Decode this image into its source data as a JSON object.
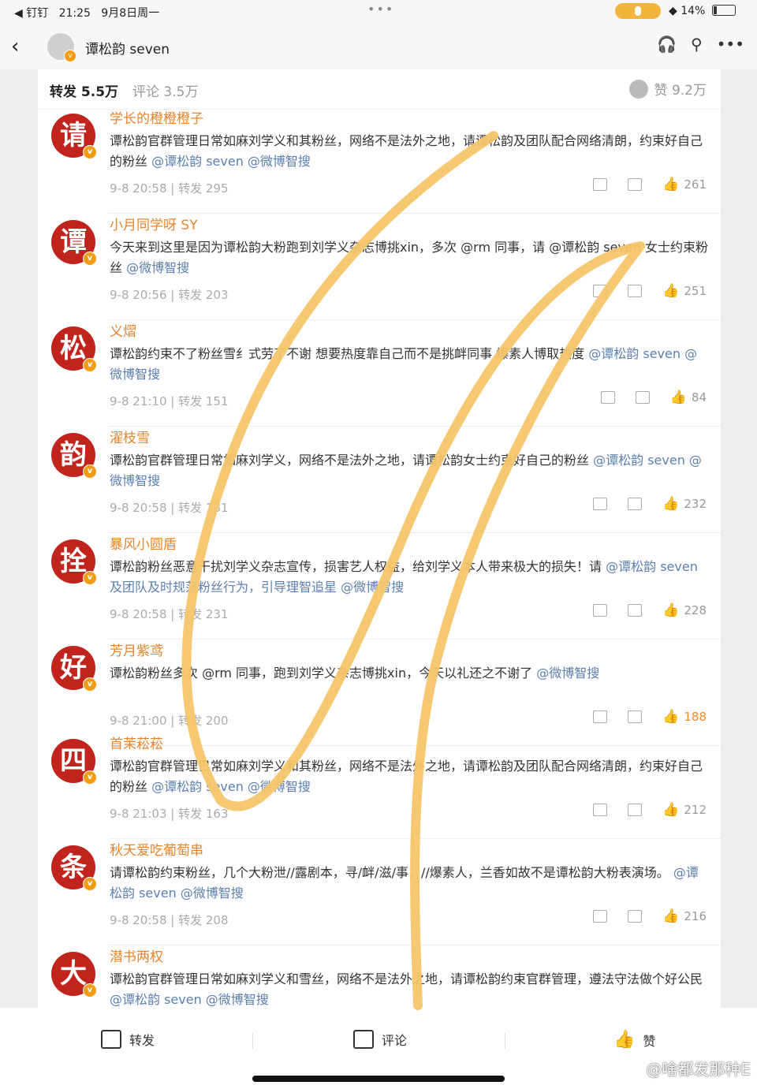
{
  "status": {
    "carrier": "◀ 钉钉",
    "time": "21:25",
    "date": "9月8日周一",
    "battery": "14%"
  },
  "nav": {
    "back": "‹",
    "title": "谭松韵 seven"
  },
  "tabs": {
    "repost": "转发 5.5万",
    "comment": "评论 3.5万",
    "likes": "赞 9.2万"
  },
  "comments": [
    {
      "avatar": "请",
      "name": "学长的橙橙橙子",
      "text": "谭松韵官群管理日常如麻刘学义和其粉丝，网络不是法外之地，请谭松韵及团队配合网络清朗，约束好自己的粉丝",
      "mentions": "@谭松韵 seven @微博智搜",
      "time": "9-8 20:58",
      "repost": "转发 295",
      "likes": "261"
    },
    {
      "avatar": "谭",
      "name": "小月同学呀 SY",
      "text": "今天来到这里是因为谭松韵大粉跑到刘学义杂志博挑xin，多次 @rm 同事，请 @谭松韵 seven 女士约束粉丝",
      "mentions": "@微博智搜",
      "time": "9-8 20:56",
      "repost": "转发 203",
      "likes": "251"
    },
    {
      "avatar": "松",
      "name": "义熠",
      "text": "谭松韵约束不了粉丝雪纟式劳了不谢 想要热度靠自己而不是挑衅同事 爆素人博取热度",
      "mentions": "@谭松韵 seven @微博智搜",
      "time": "9-8 21:10",
      "repost": "转发 151",
      "likes": "84"
    },
    {
      "avatar": "韵",
      "name": "濯枝雪",
      "text": "谭松韵官群管理日常如麻刘学义，网络不是法外之地，请谭松韵女士约束好自己的粉丝",
      "mentions": "@谭松韵 seven @微博智搜",
      "time": "9-8 20:58",
      "repost": "转发 181",
      "likes": "232"
    },
    {
      "avatar": "拴",
      "name": "暴风小圆盾",
      "text": "谭松韵粉丝恶意干扰刘学义杂志宣传，损害艺人权益，给刘学义本人带来极大的损失！请",
      "mentions": "@谭松韵 seven 及团队及时规范粉丝行为，引导理智追星 @微博智搜",
      "time": "9-8 20:58",
      "repost": "转发 231",
      "likes": "228"
    },
    {
      "avatar": "好",
      "name": "芳月紫鸢",
      "text": "谭松韵粉丝多次 @rm 同事，跑到刘学义杂志博挑xin，今天以礼还之不谢了",
      "mentions": "@微博智搜",
      "time": "9-8 21:00",
      "repost": "转发 200",
      "likes": "188"
    },
    {
      "avatar": "四",
      "name": "首茉菘菘",
      "text": "谭松韵官群管理日常如麻刘学义和其粉丝，网络不是法外之地，请谭松韵及团队配合网络清朗，约束好自己的粉丝",
      "mentions": "@谭松韵 seven @微博智搜",
      "time": "9-8 21:03",
      "repost": "转发 163",
      "likes": "212"
    },
    {
      "avatar": "条",
      "name": "秋天爱吃葡萄串",
      "text": "请谭松韵约束粉丝，几个大粉泄//露剧本，寻/衅/滋/事，//爆素人，兰香如故不是谭松韵大粉表演场。",
      "mentions": "@谭松韵 seven @微博智搜",
      "time": "9-8 20:58",
      "repost": "转发 208",
      "likes": "216"
    },
    {
      "avatar": "大",
      "name": "潜书两权",
      "text": "谭松韵官群管理日常如麻刘学义和雪丝，网络不是法外之地，请谭松韵约束官群管理，遵法守法做个好公民",
      "mentions": "@谭松韵 seven @微博智搜",
      "time": "",
      "repost": "",
      "likes": ""
    }
  ],
  "bottom": {
    "repost": "转发",
    "comment": "评论",
    "like": "赞"
  },
  "watermark": "@啥都发那种E",
  "colors": {
    "accent": "#e8852c",
    "avatar_red": "#c0241c",
    "stroke": "#f5c56a"
  }
}
